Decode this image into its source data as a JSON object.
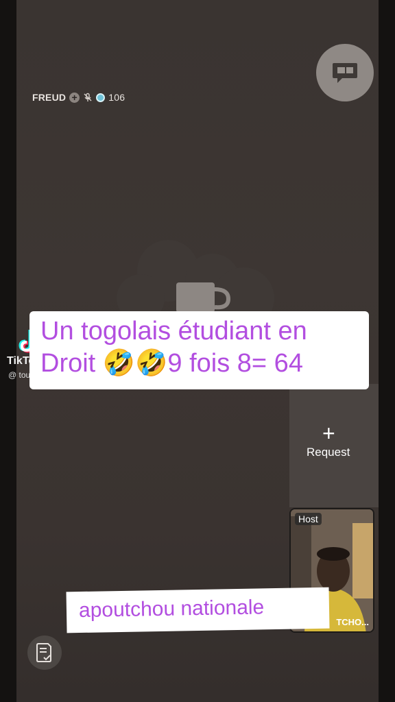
{
  "room": {
    "user_name": "FREUD",
    "viewer_count": "106"
  },
  "caption": {
    "line1": "Un togolais étudiant en",
    "line2": "Droit 🤣🤣9 fois 8= 64"
  },
  "watermark": {
    "brand": "TikTok",
    "handle": "@ toussav..."
  },
  "request": {
    "label": "Request"
  },
  "host": {
    "tag": "Host",
    "name": "TCHO..."
  },
  "nickname": {
    "text": "apoutchou nationale"
  },
  "icons": {
    "chat": "chat-bubble-icon",
    "mic": "mic-muted-icon",
    "coin": "coin-icon",
    "document": "document-check-icon",
    "plus": "plus-icon"
  },
  "colors": {
    "caption_text": "#b24ee0",
    "caption_bg": "#ffffff",
    "background": "#3a3431"
  }
}
